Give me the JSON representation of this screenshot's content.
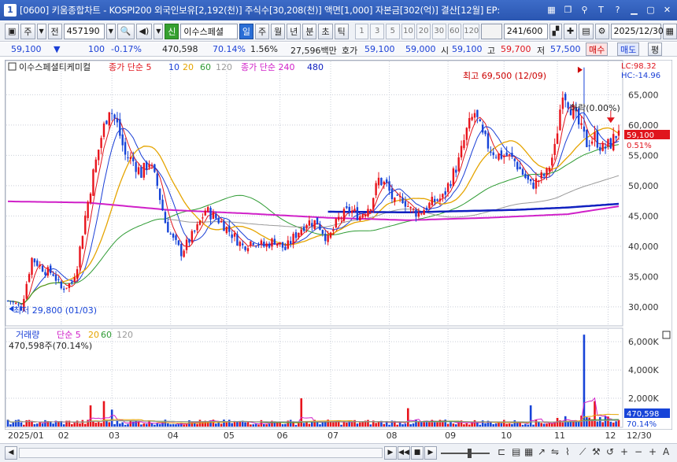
{
  "window": {
    "number": "1",
    "title": "[0600] 키움종합차트 - KOSPI200 외국인보유[2,192(천)] 주식수[30,208(천)] 액면[1,000] 자본금[302(억)] 결산[12월] EP:"
  },
  "toolbar": {
    "market": "주",
    "prev": "전",
    "code": "457190",
    "stock_name": "이수스페셜",
    "new_badge": "신",
    "periods": [
      "일",
      "주",
      "월",
      "년",
      "분",
      "초",
      "틱"
    ],
    "active_period": "일",
    "numbers": [
      "1",
      "3",
      "5",
      "10",
      "20",
      "30",
      "60",
      "120"
    ],
    "count": "241",
    "count_total": "/600",
    "date": "2025/12/30"
  },
  "quote": {
    "price": "59,100",
    "arrow": "▼",
    "change": "100",
    "change_pct": "-0.17%",
    "volume": "470,598",
    "vol_ratio": "70.14%",
    "turnover": "1.56%",
    "amount": "27,596백만",
    "bid_label": "호가",
    "bid1": "59,100",
    "bid2": "59,000",
    "open_label": "시",
    "open": "59,100",
    "high_label": "고",
    "high": "59,700",
    "low_label": "저",
    "low": "57,500",
    "buy": "매수",
    "sell": "매도",
    "eval": "평"
  },
  "price_legend": {
    "name": "이수스페셜티케미컬",
    "ma1": "종가 단순 5",
    "ma1_extra": [
      "10",
      "20",
      "60",
      "120"
    ],
    "ma2": "종가 단순 240",
    "ma2_extra": "480"
  },
  "lc_hc": {
    "lc": "LC:98.32",
    "hc": "HC:-14.96"
  },
  "annotations": {
    "high": "최고 69,500 (12/09)",
    "low": "최저 29,800 (01/03)",
    "drop": "하락(0.00%)"
  },
  "current_label": {
    "price": "59,100",
    "pct": "0.51%"
  },
  "volume_legend": {
    "name": "거래량",
    "ma": "단순 5",
    "extras": [
      "20",
      "60",
      "120"
    ],
    "value": "470,598주(70.14%)"
  },
  "volume_current": {
    "value": "470,598",
    "pct": "70.14%"
  },
  "colors": {
    "up": "#e8141c",
    "down": "#1744d8",
    "ma5": "#e0151d",
    "ma10": "#1a3fd6",
    "ma20": "#e5a400",
    "ma60": "#2e9b33",
    "ma120": "#9a9a9a",
    "ma240": "#d020c8",
    "ma480": "#1020c0"
  },
  "chart_data": [
    {
      "type": "candlestick",
      "title": "이수스페셜티케미컬",
      "x_labels": [
        "2025/01",
        "02",
        "03",
        "04",
        "05",
        "06",
        "07",
        "08",
        "09",
        "10",
        "11",
        "12",
        "12/30"
      ],
      "y_ticks": [
        30000,
        35000,
        40000,
        45000,
        50000,
        55000,
        60000,
        65000
      ],
      "ylim": [
        27000,
        70500
      ],
      "grid": true,
      "series": [
        {
          "name": "price",
          "values": [
            [
              1,
              31000
            ],
            [
              5,
              29800
            ],
            [
              9,
              38000
            ],
            [
              14,
              36000
            ],
            [
              17,
              35500
            ],
            [
              20,
              33000
            ],
            [
              24,
              34000
            ],
            [
              26,
              37000
            ],
            [
              29,
              45000
            ],
            [
              32,
              52000
            ],
            [
              35,
              58000
            ],
            [
              38,
              63000
            ],
            [
              41,
              60000
            ],
            [
              44,
              55000
            ],
            [
              47,
              54000
            ],
            [
              50,
              52000
            ],
            [
              53,
              54000
            ],
            [
              56,
              50000
            ],
            [
              59,
              44000
            ],
            [
              62,
              41000
            ],
            [
              65,
              39000
            ],
            [
              68,
              41000
            ],
            [
              71,
              43000
            ],
            [
              74,
              46000
            ],
            [
              77,
              45000
            ],
            [
              80,
              44000
            ],
            [
              84,
              42000
            ],
            [
              88,
              40000
            ],
            [
              92,
              41000
            ],
            [
              96,
              40000
            ],
            [
              100,
              41000
            ],
            [
              104,
              39500
            ],
            [
              108,
              42000
            ],
            [
              112,
              44000
            ],
            [
              116,
              44000
            ],
            [
              120,
              41000
            ],
            [
              124,
              44500
            ],
            [
              128,
              46000
            ],
            [
              132,
              45000
            ],
            [
              136,
              47000
            ],
            [
              139,
              51000
            ],
            [
              142,
              50000
            ],
            [
              145,
              47000
            ],
            [
              148,
              48000
            ],
            [
              151,
              46000
            ],
            [
              154,
              45500
            ],
            [
              157,
              46500
            ],
            [
              160,
              47500
            ],
            [
              163,
              48000
            ],
            [
              166,
              51000
            ],
            [
              169,
              54000
            ],
            [
              172,
              59000
            ],
            [
              175,
              62000
            ],
            [
              178,
              58000
            ],
            [
              181,
              56000
            ],
            [
              184,
              55000
            ],
            [
              187,
              55000
            ],
            [
              190,
              54000
            ],
            [
              193,
              52000
            ],
            [
              196,
              50000
            ],
            [
              199,
              51000
            ],
            [
              202,
              52000
            ],
            [
              205,
              56000
            ],
            [
              208,
              66000
            ],
            [
              211,
              63000
            ],
            [
              214,
              60000
            ],
            [
              217,
              57000
            ],
            [
              220,
              58000
            ],
            [
              223,
              56000
            ],
            [
              226,
              57000
            ],
            [
              229,
              59100
            ]
          ]
        },
        {
          "name": "종가 단순 240",
          "values": [
            [
              0,
              47400
            ],
            [
              30,
              47200
            ],
            [
              60,
              46000
            ],
            [
              90,
              45400
            ],
            [
              120,
              44700
            ],
            [
              150,
              44300
            ],
            [
              180,
              44700
            ],
            [
              210,
              45300
            ],
            [
              229,
              46600
            ]
          ]
        },
        {
          "name": "480",
          "values": [
            [
              120,
              45700
            ],
            [
              150,
              45600
            ],
            [
              170,
              45800
            ],
            [
              190,
              46000
            ],
            [
              210,
              46400
            ],
            [
              229,
              47000
            ]
          ]
        }
      ]
    },
    {
      "type": "bar",
      "title": "거래량",
      "y_ticks": [
        2000,
        4000,
        6000
      ],
      "tick_labels": [
        "2,000K",
        "4,000K",
        "6,000K"
      ],
      "ylim": [
        0,
        6900
      ],
      "highlights": [
        {
          "index": 31,
          "value": 1500
        },
        {
          "index": 36,
          "value": 1800
        },
        {
          "index": 39,
          "value": 1200
        },
        {
          "index": 110,
          "value": 2000
        },
        {
          "index": 150,
          "value": 1300
        },
        {
          "index": 196,
          "value": 1500
        },
        {
          "index": 216,
          "value": 6500
        },
        {
          "index": 220,
          "value": 1800
        }
      ]
    }
  ]
}
